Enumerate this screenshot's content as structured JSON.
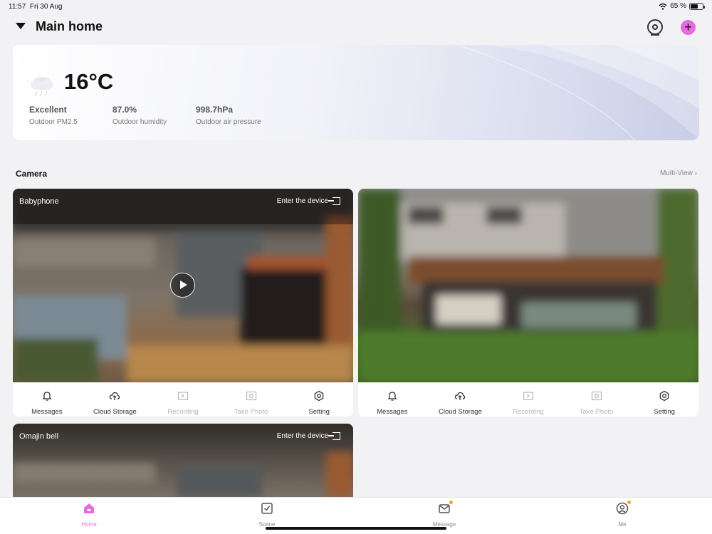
{
  "status_bar": {
    "time": "11:57",
    "date": "Fri 30 Aug",
    "battery": "65 %",
    "battery_level": 0.65
  },
  "header": {
    "home_name": "Main home"
  },
  "weather": {
    "temperature": "16°C",
    "stats": [
      {
        "value": "Excellent",
        "label": "Outdoor PM2.5"
      },
      {
        "value": "87.0%",
        "label": "Outdoor humidity"
      },
      {
        "value": "998.7hPa",
        "label": "Outdoor air pressure"
      }
    ]
  },
  "camera_section": {
    "title": "Camera",
    "multi_view": "Multi-View ›"
  },
  "cameras": [
    {
      "name": "Babyphone",
      "enter": "Enter the device"
    },
    {
      "name": "",
      "enter": ""
    },
    {
      "name": "Omajin bell",
      "enter": "Enter the device"
    }
  ],
  "camera_actions": [
    "Messages",
    "Cloud Storage",
    "Recording",
    "Take Photo",
    "Setting"
  ],
  "tabs": [
    "Home",
    "Scene",
    "Message",
    "Me"
  ],
  "colors": {
    "accent": "#e86ae0",
    "badge": "#f7a21b"
  }
}
